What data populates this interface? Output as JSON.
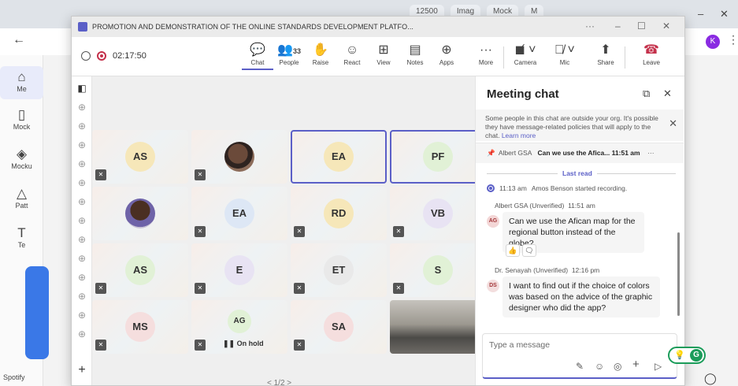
{
  "browser": {
    "tabs": [
      "12500",
      "Imag",
      "Mock",
      "M"
    ],
    "profile_initial": "K",
    "left_app_items": [
      {
        "label": "Me",
        "icon": "home-icon"
      },
      {
        "label": "Mock",
        "icon": "doc-icon"
      },
      {
        "label": "Mocku",
        "icon": "cube-icon"
      },
      {
        "label": "Patt",
        "icon": "shapes-icon"
      },
      {
        "label": "Te",
        "icon": "text-icon"
      }
    ],
    "bottom_label": "Spotify"
  },
  "window": {
    "title": "PROMOTION AND DEMONSTRATION OF THE ONLINE STANDARDS DEVELOPMENT PLATFO...",
    "more": "···"
  },
  "toolbar": {
    "recording_time": "02:17:50",
    "people_count": "33",
    "buttons": [
      {
        "label": "Chat",
        "icon": "chat-icon"
      },
      {
        "label": "People",
        "icon": "people-icon"
      },
      {
        "label": "Raise",
        "icon": "hand-icon"
      },
      {
        "label": "React",
        "icon": "smile-icon"
      },
      {
        "label": "View",
        "icon": "grid-icon"
      },
      {
        "label": "Notes",
        "icon": "notes-icon"
      },
      {
        "label": "Apps",
        "icon": "plus-box-icon"
      },
      {
        "label": "More",
        "icon": "more-icon"
      },
      {
        "label": "Camera",
        "icon": "camera-off-icon"
      },
      {
        "label": "Mic",
        "icon": "mic-off-icon"
      },
      {
        "label": "Share",
        "icon": "share-icon"
      },
      {
        "label": "Leave",
        "icon": "phone-hangup-icon"
      }
    ]
  },
  "stage": {
    "tiles": [
      {
        "initials": "AS",
        "bg": "#f6e7b9",
        "muted": true
      },
      {
        "initials": "",
        "photo": true,
        "muted": true
      },
      {
        "initials": "EA",
        "bg": "#f6e7b9",
        "selected": true
      },
      {
        "initials": "PF",
        "bg": "#e1f1d6",
        "selected": true
      },
      {
        "initials": "",
        "photo": true,
        "muted": false
      },
      {
        "initials": "EA",
        "bg": "#dde7f5",
        "muted": true
      },
      {
        "initials": "RD",
        "bg": "#f6e7b9",
        "muted": true
      },
      {
        "initials": "VB",
        "bg": "#e8e3f3",
        "muted": true
      },
      {
        "initials": "AS",
        "bg": "#e1f1d6",
        "muted": true
      },
      {
        "initials": "E",
        "bg": "#e8e3f3",
        "muted": true
      },
      {
        "initials": "ET",
        "bg": "#e9e9e9",
        "muted": true
      },
      {
        "initials": "S",
        "bg": "#e1f1d6",
        "muted": true
      },
      {
        "initials": "MS",
        "bg": "#f5dede",
        "muted": true
      },
      {
        "initials": "AG",
        "bg": "#e1f1d6",
        "muted": true,
        "hold": "On hold"
      },
      {
        "initials": "SA",
        "bg": "#f5dede",
        "muted": true
      },
      {
        "initials": "",
        "camera": true
      }
    ],
    "pager": "< 1/2 >"
  },
  "chat": {
    "title": "Meeting chat",
    "notice_text": "Some people in this chat are outside your org. It's possible they have message-related policies that will apply to the chat.",
    "notice_link": "Learn more",
    "pinned_sender": "Albert GSA",
    "pinned_text": "Can we use the Afica...",
    "pinned_time": "11:51 am",
    "last_read": "Last read",
    "system_time": "11:13 am",
    "system_text": "Amos Benson started recording.",
    "messages": [
      {
        "sender": "Albert GSA (Unverified)",
        "time": "11:51 am",
        "initials": "AG",
        "text": "Can we use the Afican map for the regional button instead of the globe?",
        "reactions": [
          "👍",
          "🗨"
        ]
      },
      {
        "sender": "Dr. Senayah (Unverified)",
        "time": "12:16 pm",
        "initials": "DS",
        "text": "I want to find out if the choice of colors was based on the advice of the graphic designer who did the app?"
      }
    ],
    "composer_placeholder": "Type a message"
  },
  "colors": {
    "accent": "#5b5fc7",
    "leave": "#c4314b",
    "recording": "#c4314b"
  }
}
